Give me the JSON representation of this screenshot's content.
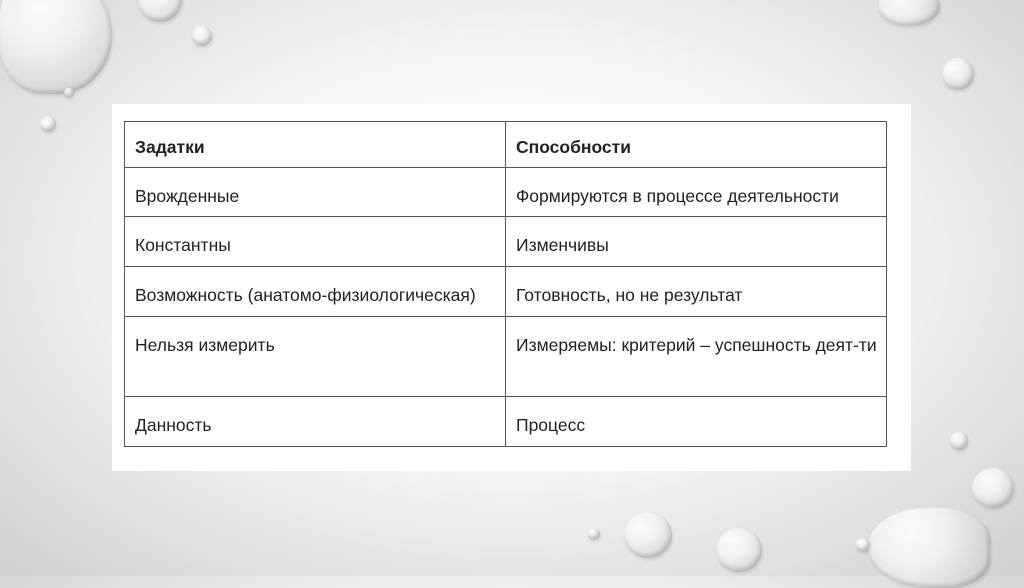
{
  "table": {
    "headers": [
      "Задатки",
      "Способности"
    ],
    "rows": [
      [
        "Врожденные",
        "Формируются в процессе деятельности"
      ],
      [
        "Константны",
        "Изменчивы"
      ],
      [
        "Возможность (анатомо-физиологическая)",
        "Готовность, но не результат"
      ],
      [
        "Нельзя измерить",
        "Измеряемы: критерий – успешность деят-ти"
      ],
      [
        "Данность",
        "Процесс"
      ]
    ]
  }
}
